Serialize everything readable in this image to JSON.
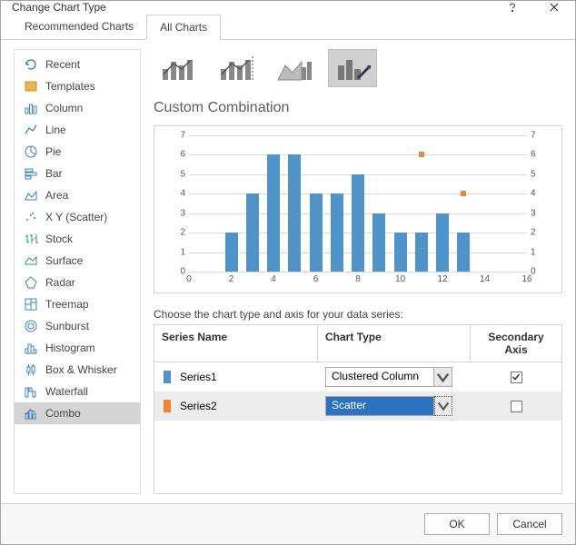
{
  "dialog": {
    "title": "Change Chart Type",
    "tabs": [
      "Recommended Charts",
      "All Charts"
    ],
    "active_tab": 1,
    "ok_label": "OK",
    "cancel_label": "Cancel"
  },
  "sidebar": {
    "items": [
      {
        "label": "Recent"
      },
      {
        "label": "Templates"
      },
      {
        "label": "Column"
      },
      {
        "label": "Line"
      },
      {
        "label": "Pie"
      },
      {
        "label": "Bar"
      },
      {
        "label": "Area"
      },
      {
        "label": "X Y (Scatter)"
      },
      {
        "label": "Stock"
      },
      {
        "label": "Surface"
      },
      {
        "label": "Radar"
      },
      {
        "label": "Treemap"
      },
      {
        "label": "Sunburst"
      },
      {
        "label": "Histogram"
      },
      {
        "label": "Box & Whisker"
      },
      {
        "label": "Waterfall"
      },
      {
        "label": "Combo"
      }
    ],
    "selected_index": 16
  },
  "main": {
    "subtype_selected": 3,
    "section_title": "Custom Combination",
    "series_instruction": "Choose the chart type and axis for your data series:",
    "columns": {
      "name": "Series Name",
      "type": "Chart Type",
      "axis": "Secondary Axis"
    },
    "series": [
      {
        "name": "Series1",
        "color": "#4f93c9",
        "chart_type": "Clustered Column",
        "secondary": true
      },
      {
        "name": "Series2",
        "color": "#ee8434",
        "chart_type": "Scatter",
        "secondary": false
      }
    ]
  },
  "chart_data": {
    "type": "combo",
    "title": "",
    "x_range": [
      0,
      16
    ],
    "left_axis": {
      "range": [
        0,
        7
      ],
      "ticks": [
        0,
        1,
        2,
        3,
        4,
        5,
        6,
        7
      ]
    },
    "right_axis": {
      "range": [
        0,
        7
      ],
      "ticks": [
        0,
        1,
        2,
        3,
        4,
        5,
        6,
        7
      ]
    },
    "x_ticks": [
      0,
      2,
      4,
      6,
      8,
      10,
      12,
      14,
      16
    ],
    "series": [
      {
        "name": "Series1",
        "type": "bar",
        "axis": "right",
        "x": [
          2,
          3,
          4,
          5,
          6,
          7,
          8,
          9,
          10,
          11,
          12,
          13
        ],
        "y": [
          2,
          4,
          6,
          6,
          4,
          4,
          5,
          3,
          2,
          2,
          3,
          2
        ]
      },
      {
        "name": "Series2",
        "type": "scatter",
        "axis": "left",
        "x": [
          11,
          13
        ],
        "y": [
          6,
          4
        ]
      }
    ]
  }
}
